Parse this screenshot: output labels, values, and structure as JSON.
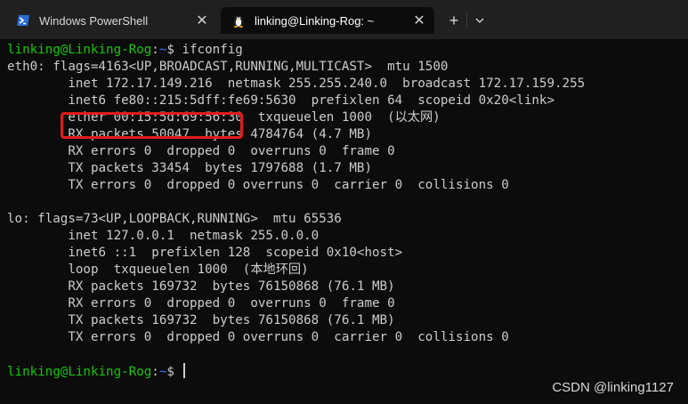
{
  "tabs": [
    {
      "label": "Windows PowerShell",
      "icon": "powershell-icon",
      "close": "✕"
    },
    {
      "label": "linking@Linking-Rog: ~",
      "icon": "linux-penguin-icon",
      "close": "✕"
    }
  ],
  "newtab": {
    "label": "+"
  },
  "terminal": {
    "prompt": {
      "user": "linking@Linking-Rog",
      "sep": ":",
      "path": "~",
      "sym": "$",
      "cmd": " ifconfig"
    },
    "lines": [
      "eth0: flags=4163<UP,BROADCAST,RUNNING,MULTICAST>  mtu 1500",
      "        inet 172.17.149.216  netmask 255.255.240.0  broadcast 172.17.159.255",
      "        inet6 fe80::215:5dff:fe69:5630  prefixlen 64  scopeid 0x20<link>",
      "        ether 00:15:5d:69:56:30  txqueuelen 1000  (以太网)",
      "        RX packets 50047  bytes 4784764 (4.7 MB)",
      "        RX errors 0  dropped 0  overruns 0  frame 0",
      "        TX packets 33454  bytes 1797688 (1.7 MB)",
      "        TX errors 0  dropped 0 overruns 0  carrier 0  collisions 0",
      "",
      "lo: flags=73<UP,LOOPBACK,RUNNING>  mtu 65536",
      "        inet 127.0.0.1  netmask 255.0.0.0",
      "        inet6 ::1  prefixlen 128  scopeid 0x10<host>",
      "        loop  txqueuelen 1000  (本地环回)",
      "        RX packets 169732  bytes 76150868 (76.1 MB)",
      "        RX errors 0  dropped 0  overruns 0  frame 0",
      "        TX packets 169732  bytes 76150868 (76.1 MB)",
      "        TX errors 0  dropped 0 overruns 0  carrier 0  collisions 0",
      ""
    ],
    "prompt2": {
      "user": "linking@Linking-Rog",
      "sep": ":",
      "path": "~",
      "sym": "$ "
    }
  },
  "watermark": "CSDN @linking1127",
  "colors": {
    "background": "#0c0c0c",
    "prompt_user": "#16c60c",
    "prompt_path": "#3b78ff",
    "highlight": "#e21b1b"
  }
}
